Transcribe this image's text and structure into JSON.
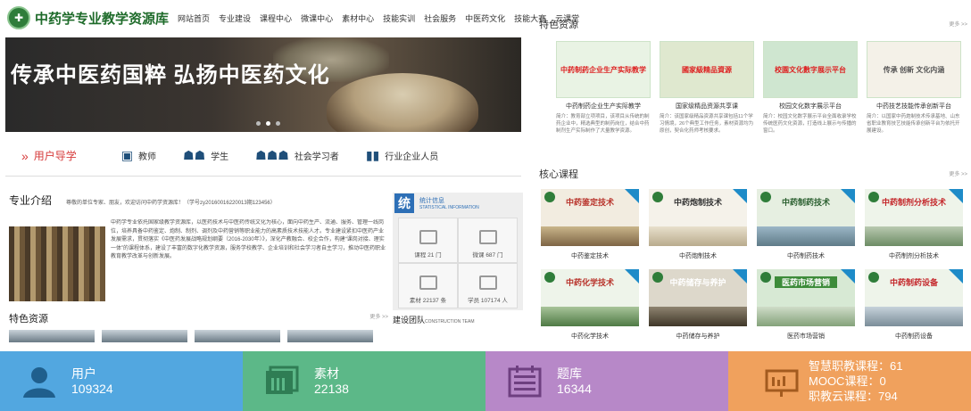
{
  "header": {
    "logo_text": "中药学专业教学资源库",
    "nav": [
      "网站首页",
      "专业建设",
      "课程中心",
      "微课中心",
      "素材中心",
      "技能实训",
      "社会服务",
      "中医药文化",
      "技能大赛",
      "云课堂"
    ]
  },
  "banner": {
    "title": "传承中医药国粹  弘扬中医药文化"
  },
  "user_guide": {
    "label": "用户导学",
    "roles": [
      "教师",
      "学生",
      "社会学习者",
      "行业企业人员"
    ]
  },
  "intro": {
    "title": "专业介绍",
    "subtitle": "尊敬的单位专家、朋友，欢迎访问中药学资源库！（学号zy20160016220013期123456）",
    "body": "中药学专业依托国家级教学资源库，以医药技术与中医药传统文化为核心，面向中药生产、流通、服务、管理一线岗位，培养具备中药鉴定、炮制、制剂、调剂及中药营销等职业能力的高素质技术技能人才。专业建设紧扣中医药产业发展需求，贯彻落实《中医药发展战略规划纲要（2016-2030年）》，深化产教融合、校企合作，构建“课岗对接、理实一体”的课程体系，建设了丰富的数字化教学资源，服务学校教学、企业培训和社会学习者自主学习，推动中医药职业教育教学改革与创新发展。"
  },
  "stats": {
    "title": "统计信息",
    "subtitle": "STATISTICAL INFORMATION",
    "tong": "统",
    "items": [
      "课程 21 门",
      "微课 687 门",
      "素材 22137 条",
      "学员 107174 人"
    ]
  },
  "left_features": {
    "title": "特色资源",
    "more": "更多 >>"
  },
  "team": {
    "title": "建设团队",
    "en": "CONSTRUCTION TEAM"
  },
  "right_features": {
    "title": "特色资源",
    "more": "更多 >>",
    "cards": [
      {
        "img_text": "中药制药企业生产实际教学",
        "title": "中药制药企业生产实际教学",
        "desc": "简介：教育部立项项目，该项目从传统的制药企业中，精选典型的制药岗位，结合中药制剂生产实际制作了大量教学资源。"
      },
      {
        "img_text": "國家級精品資源",
        "title": "国家级精品资源共享课",
        "desc": "简介：该国家级精品资源共享课包括11个学习情境，26个典型工作任务，素材资源均为原创，契合化药师考核要求。"
      },
      {
        "img_text": "校園文化數字展示平台",
        "title": "校园文化数字展示平台",
        "desc": "简介：校园文化数字展示平台全面收录学校传统医药文化资源，打造线上展示与传播的窗口。"
      },
      {
        "img_text": "传承 创新 文化内涵",
        "title": "中药技艺技能传承创新平台",
        "desc": "简介：以国家中药炮制技术传承基地、山东省职业教育技艺技能传承创新平台为依托开展建设。"
      }
    ]
  },
  "core_courses": {
    "title": "核心课程",
    "more": "更多 >>",
    "courses": [
      {
        "img_text": "中药鉴定技术",
        "title": "中药鉴定技术"
      },
      {
        "img_text": "中药炮制技术",
        "title": "中药炮制技术"
      },
      {
        "img_text": "中药制药技术",
        "title": "中药制药技术"
      },
      {
        "img_text": "中药制剂分析技术",
        "title": "中药制剂分析技术"
      },
      {
        "img_text": "中药化学技术",
        "title": "中药化学技术"
      },
      {
        "img_text": "中药储存与养护",
        "title": "中药储存与养护"
      },
      {
        "img_text": "医药市场营销",
        "title": "医药市场营销"
      },
      {
        "img_text": "中药制药设备",
        "title": "中药制药设备"
      }
    ]
  },
  "stat_bar": {
    "users": {
      "label": "用户",
      "value": "109324",
      "color": "#52a7e0"
    },
    "materials": {
      "label": "素材",
      "value": "22138",
      "color": "#5cb888"
    },
    "questions": {
      "label": "题库",
      "value": "16344",
      "color": "#b788c8"
    },
    "courses": {
      "lines": [
        "智慧职教课程：61",
        "MOOC课程：0",
        "职教云课程：794"
      ],
      "color": "#f0a15d"
    }
  },
  "icons": {
    "user": "user-silhouette-icon",
    "materials": "folder-icon",
    "questions": "list-icon",
    "courses": "presentation-board-icon"
  }
}
